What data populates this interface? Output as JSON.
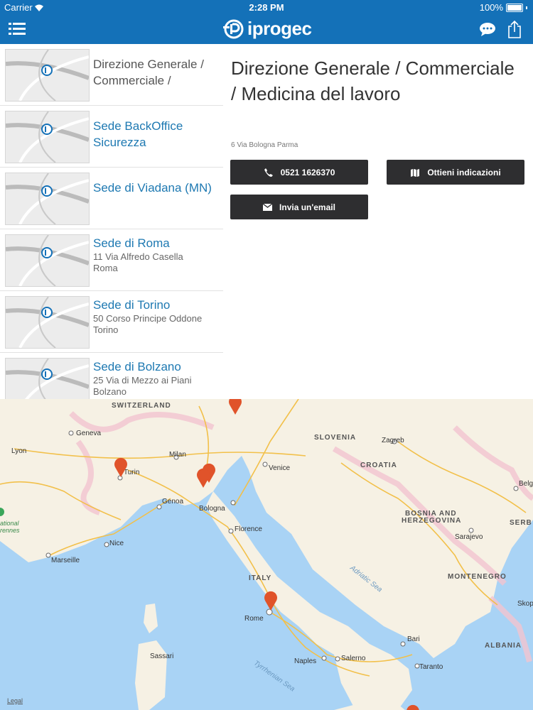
{
  "status_bar": {
    "carrier": "Carrier",
    "time": "2:28 PM",
    "battery": "100%"
  },
  "nav": {
    "menu_icon": "list-menu-icon",
    "logo_text": "iprogec",
    "chat_icon": "chat-bubble-icon",
    "share_icon": "share-icon",
    "brand_color": "#1471b8"
  },
  "locations": [
    {
      "title": "Direzione Generale / Commerciale /",
      "address": "",
      "city": ""
    },
    {
      "title": "Sede BackOffice Sicurezza",
      "address": "",
      "city": ""
    },
    {
      "title": "Sede di Viadana (MN)",
      "address": "",
      "city": ""
    },
    {
      "title": "Sede di Roma",
      "address": "11 Via Alfredo Casella",
      "city": "Roma"
    },
    {
      "title": "Sede di Torino",
      "address": "50 Corso Principe Oddone",
      "city": "Torino"
    },
    {
      "title": "Sede di Bolzano",
      "address": "25 Via di Mezzo ai Piani",
      "city": "Bolzano"
    }
  ],
  "detail": {
    "title": "Direzione Generale / Commerciale /  Medicina del lavoro",
    "address": "6 Via Bologna Parma",
    "phone_label": "0521 1626370",
    "directions_label": "Ottieni indicazioni",
    "email_label": "Invia un'email"
  },
  "map": {
    "countries": [
      "SWITZERLAND",
      "SLOVENIA",
      "CROATIA",
      "BOSNIA AND",
      "HERZEGOVINA",
      "ITALY",
      "MONTENEGRO",
      "ALBANIA",
      "SERB"
    ],
    "cities": [
      "Geneva",
      "Lyon",
      "Milan",
      "Turin",
      "Genoa",
      "Venice",
      "Bologna",
      "Zagreb",
      "Florence",
      "Nice",
      "Marseille",
      "Rome",
      "Sarajevo",
      "Bari",
      "Naples",
      "Salerno",
      "Taranto",
      "Sassari",
      "Belg",
      "Skop"
    ],
    "seas": [
      "Adriatic Sea",
      "Tyrrhenian Sea"
    ],
    "park": [
      "ational",
      "rennes"
    ],
    "legal": "Legal",
    "pin_color": "#e0532a"
  }
}
